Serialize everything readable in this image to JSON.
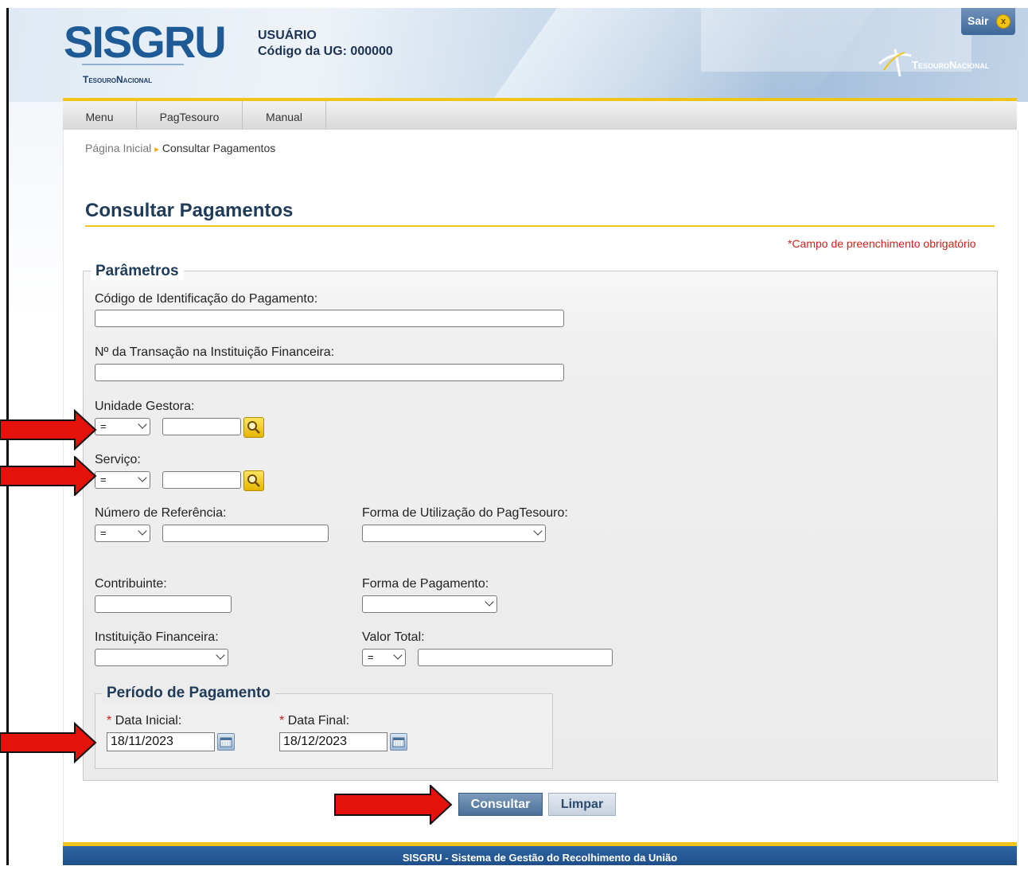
{
  "header": {
    "logo_text": "SISGRU",
    "logo_subtitle": "TesouroNacional",
    "user_label": "USUÁRIO",
    "ug_code": "Código da UG: 000000",
    "sair_label": "Sair",
    "brand_text": "TesouroNacional"
  },
  "nav": {
    "items": [
      {
        "label": "Menu"
      },
      {
        "label": "PagTesouro"
      },
      {
        "label": "Manual"
      }
    ]
  },
  "breadcrumb": {
    "home": "Página Inicial",
    "current": "Consultar Pagamentos"
  },
  "page": {
    "title": "Consultar Pagamentos",
    "required_note": "*Campo de preenchimento obrigatório"
  },
  "params": {
    "legend": "Parâmetros",
    "codigo_label": "Código de Identificação do Pagamento:",
    "codigo_value": "",
    "transacao_label": "Nº da Transação na Instituição Financeira:",
    "transacao_value": "",
    "ug_label": "Unidade Gestora:",
    "ug_operator": "=",
    "ug_value": "",
    "servico_label": "Serviço:",
    "servico_operator": "=",
    "servico_value": "",
    "referencia_label": "Número de Referência:",
    "referencia_operator": "=",
    "referencia_value": "",
    "forma_utilizacao_label": "Forma de Utilização do PagTesouro:",
    "forma_utilizacao_value": "",
    "contribuinte_label": "Contribuinte:",
    "contribuinte_value": "",
    "forma_pagamento_label": "Forma de Pagamento:",
    "forma_pagamento_value": "",
    "instituicao_label": "Instituição Financeira:",
    "instituicao_value": "",
    "valor_label": "Valor Total:",
    "valor_operator": "=",
    "valor_value": ""
  },
  "periodo": {
    "legend": "Período de Pagamento",
    "required_mark": "*",
    "data_inicial_label": "Data Inicial:",
    "data_inicial_value": "18/11/2023",
    "data_final_label": "Data Final:",
    "data_final_value": "18/12/2023"
  },
  "actions": {
    "consultar": "Consultar",
    "limpar": "Limpar"
  },
  "footer": {
    "text": "SISGRU - Sistema de Gestão do Recolhimento da União"
  },
  "colors": {
    "accent_yellow": "#f0c419",
    "title_blue": "#1f3b5a",
    "annotation_arrow": "#e3120b"
  }
}
